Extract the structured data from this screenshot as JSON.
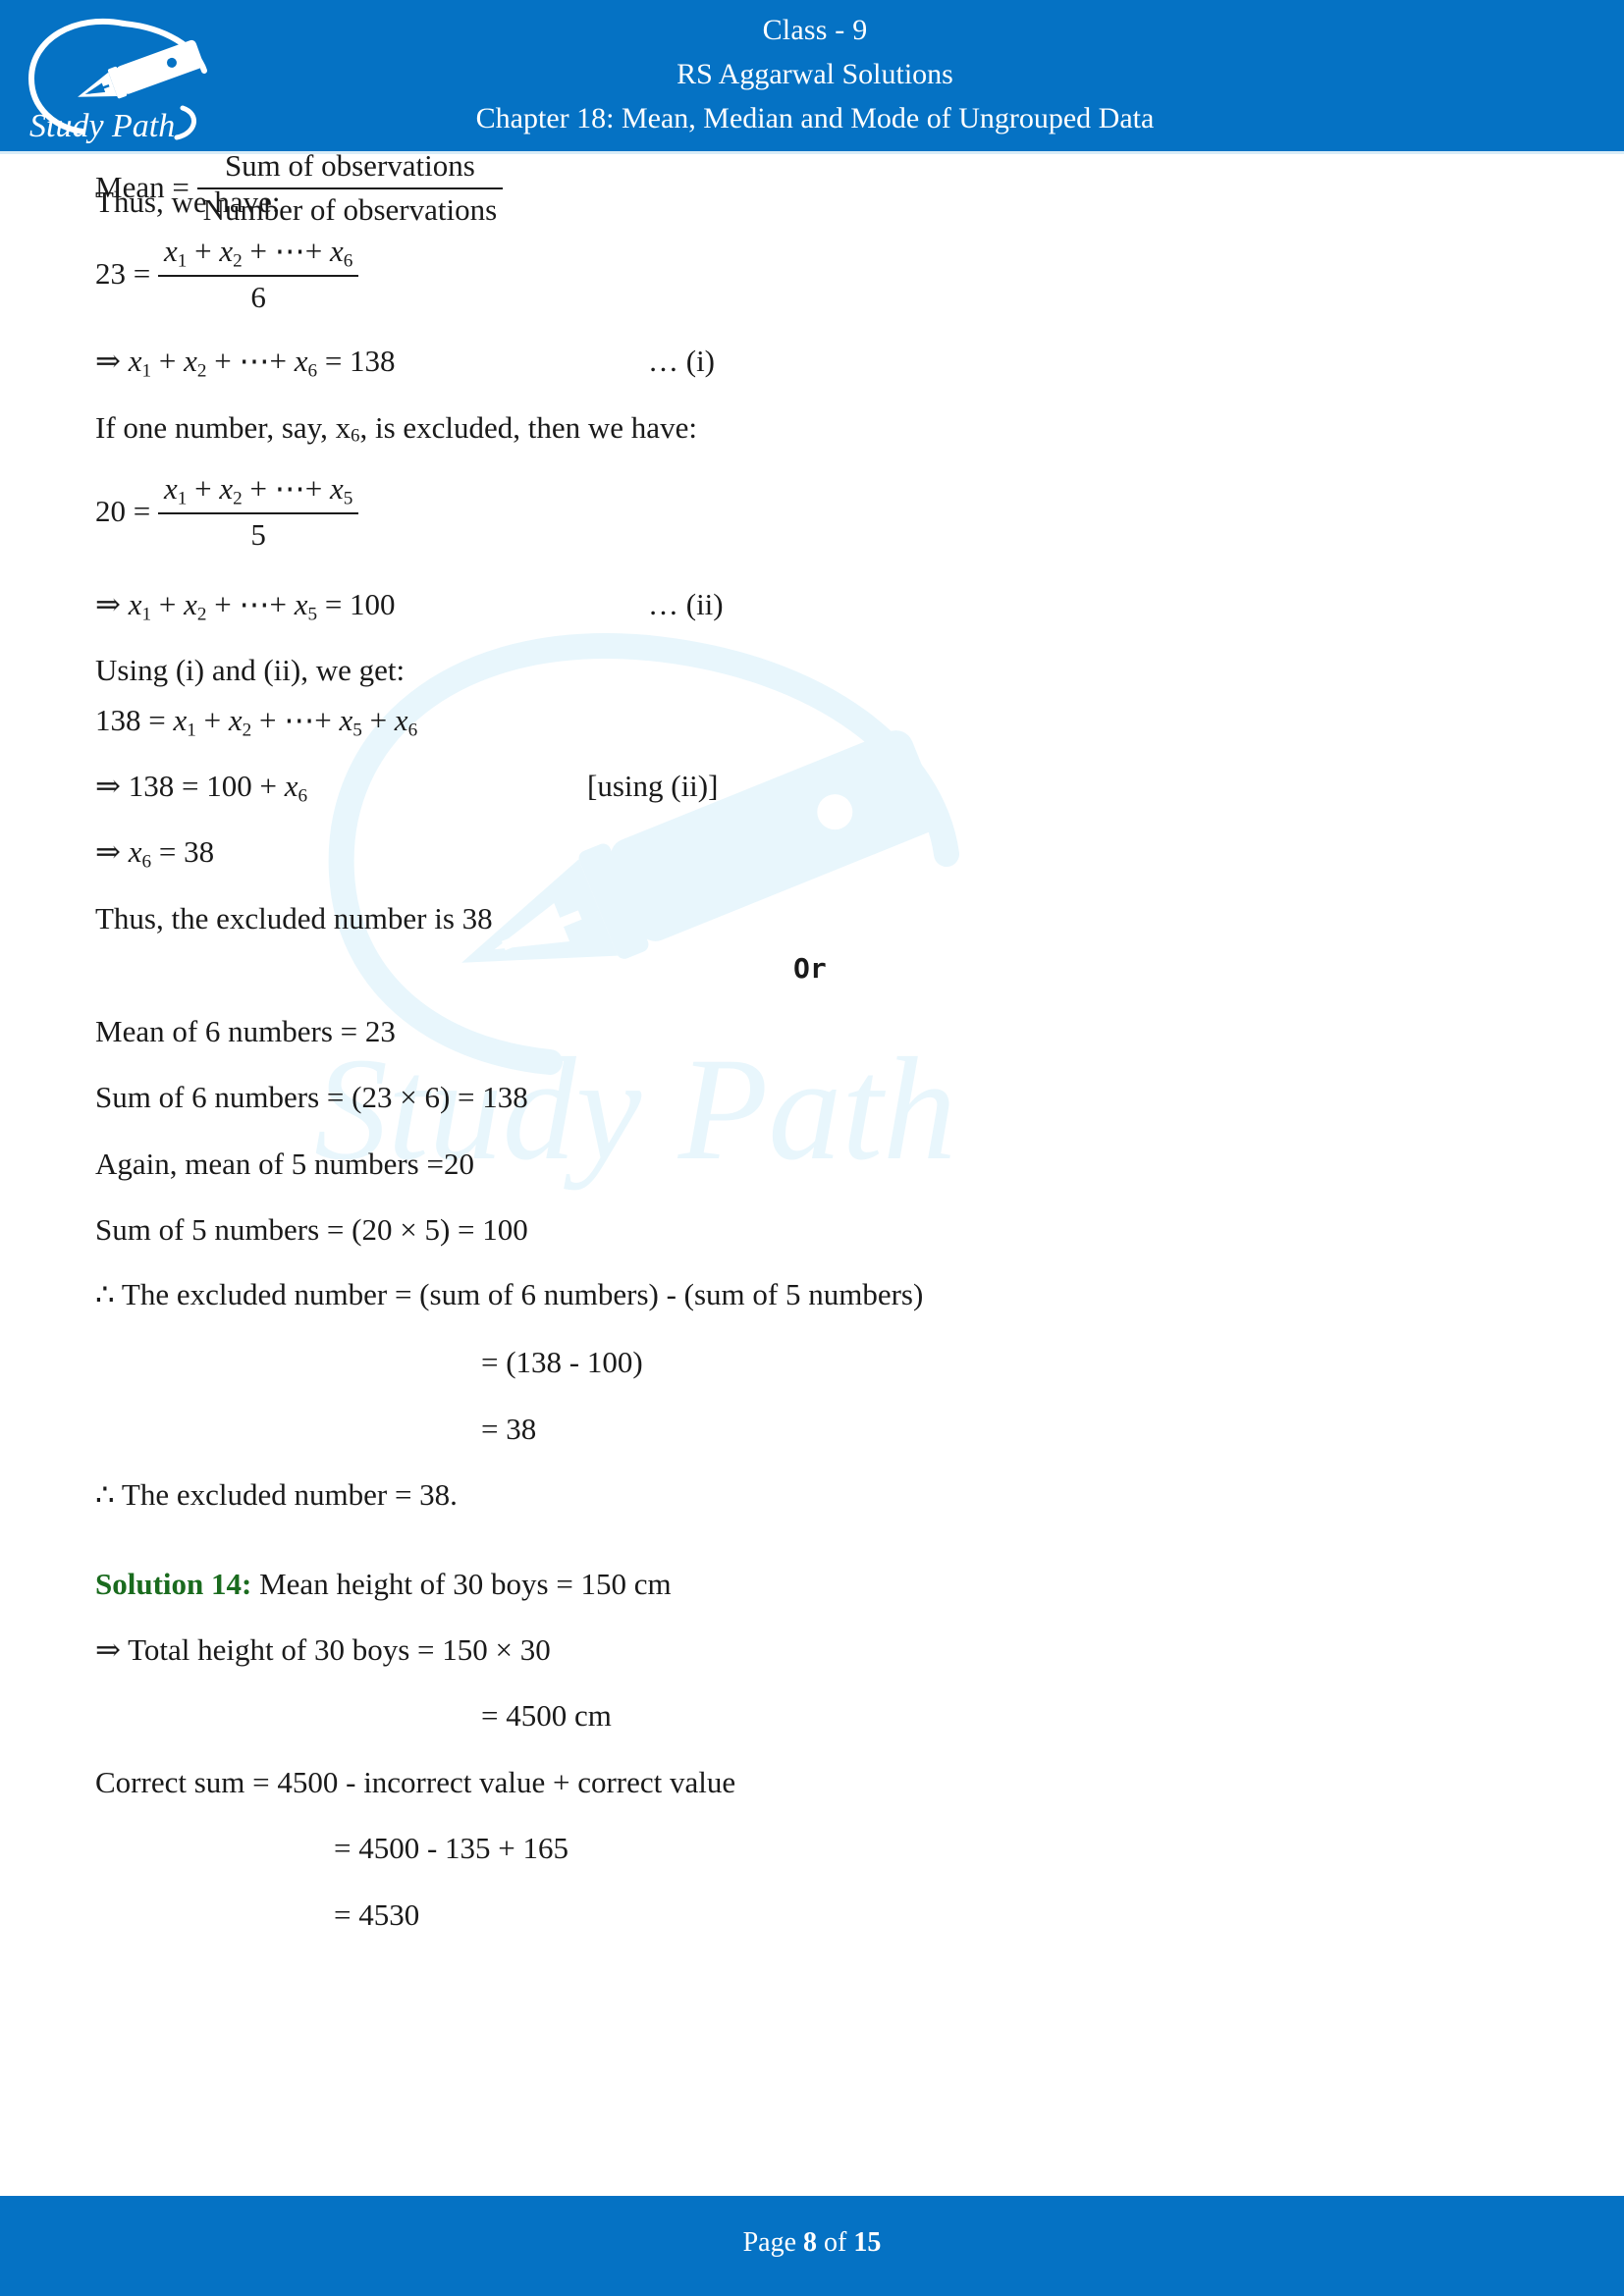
{
  "header": {
    "logo_alt": "Study Path",
    "logo_text": "Study Path",
    "line1": "Class - 9",
    "line2": "RS Aggarwal Solutions",
    "line3": "Chapter 18: Mean, Median and Mode of Ungrouped Data",
    "bg_color": "#0572C4"
  },
  "watermark": {
    "text": "Study Path",
    "color": "#e6f5fb"
  },
  "content": {
    "mean_formula": {
      "lhs": "Mean  =",
      "numerator": "Sum of observations",
      "denominator": "Number of observations"
    },
    "thus_we_have": "Thus, we have:",
    "eq23": {
      "lhs": "23 =",
      "numerator_a": "x",
      "numerator_sub1": "1",
      "numerator_plus": " + ",
      "numerator_b": "x",
      "numerator_sub2": "2",
      "numerator_mid": " + ⋯+ ",
      "numerator_c": "x",
      "numerator_sub3": "6",
      "denominator": "6"
    },
    "eq_i": {
      "arrow": "⇒ ",
      "expr_a": "x",
      "sub_a": "1",
      "plus1": " + ",
      "expr_b": "x",
      "sub_b": "2",
      "mid": " + ⋯+ ",
      "expr_c": "x",
      "sub_c": "6",
      "equals": " = 138",
      "tag": "… (i)"
    },
    "if_one_number": {
      "part1": "If one number, say, x",
      "sub": "6",
      "part2": ", is excluded, then we have:"
    },
    "eq20": {
      "lhs": "20 =",
      "numerator_a": "x",
      "numerator_sub1": "1",
      "numerator_plus": " + ",
      "numerator_b": "x",
      "numerator_sub2": "2",
      "numerator_mid": " + ⋯+ ",
      "numerator_c": "x",
      "numerator_sub3": "5",
      "denominator": "5"
    },
    "eq_ii": {
      "arrow": "⇒ ",
      "expr_a": "x",
      "sub_a": "1",
      "plus1": " + ",
      "expr_b": "x",
      "sub_b": "2",
      "mid": " + ⋯+ ",
      "expr_c": "x",
      "sub_c": "5",
      "equals": " = 100",
      "tag": "… (ii)"
    },
    "using_i_ii": "Using (i) and (ii), we get:",
    "eq138": {
      "lhs": "138 = ",
      "expr_a": "x",
      "sub_a": "1",
      "plus1": " + ",
      "expr_b": "x",
      "sub_b": "2",
      "mid": " + ⋯+ ",
      "expr_c": "x",
      "sub_c": "5",
      "plus2": " + ",
      "expr_d": "x",
      "sub_d": "6"
    },
    "eq138_100": {
      "text": "⇒ 138 = 100 + ",
      "expr": "x",
      "sub": "6",
      "tag": "[using (ii)]"
    },
    "eq_x6": {
      "arrow": "⇒ ",
      "expr": "x",
      "sub": "6",
      "equals": " = 38"
    },
    "thus_excluded": "Thus, the excluded number is 38",
    "or": "Or",
    "mean_6": "Mean of 6 numbers = 23",
    "sum_6": "Sum of 6 numbers = (23 × 6) = 138",
    "again_mean_5": "Again, mean of 5 numbers =20",
    "sum_5": "Sum of 5 numbers = (20 × 5) = 100",
    "excluded_expr": "∴ The excluded number = (sum of 6 numbers) - (sum of 5 numbers)",
    "excluded_calc": "= (138 - 100)",
    "excluded_result": "= 38",
    "excluded_final": "∴ The excluded number = 38.",
    "solution14_label": "Solution 14:",
    "solution14_text": "Mean height of 30 boys = 150 cm",
    "total_height": "⇒ Total height of 30 boys = 150 × 30",
    "total_height_val": "= 4500 cm",
    "correct_sum": "Correct sum = 4500 - incorrect value + correct value",
    "correct_sum_calc": "= 4500 - 135 + 165",
    "correct_sum_result": "= 4530"
  },
  "footer": {
    "prefix": "Page ",
    "page": "8",
    "middle": " of ",
    "total": "15",
    "bg_color": "#0572C4"
  }
}
